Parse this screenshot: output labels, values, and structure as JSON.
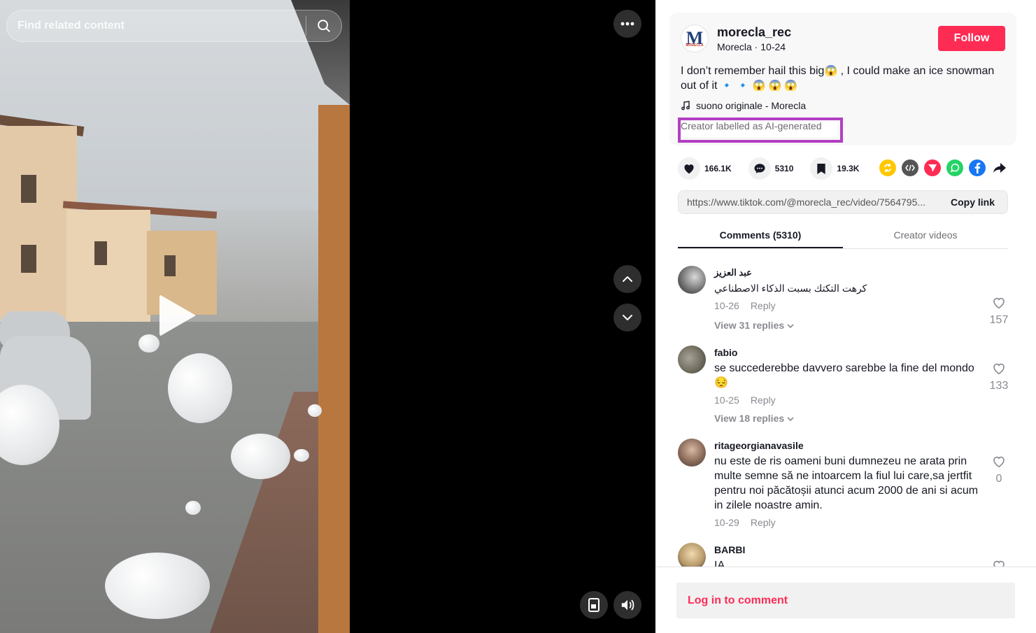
{
  "search": {
    "placeholder": "Find related content"
  },
  "post": {
    "username": "morecla_rec",
    "display_name": "Morecla",
    "date": "10-24",
    "follow_label": "Follow",
    "caption_part1": "I don’t remember hail this big",
    "caption_part2": " , I could make an ice snowman out of it ",
    "caption_emojis": "🔹 🔹 😱 😱 😱",
    "music": "suono originale - Morecla",
    "ai_label": "Creator labelled as AI-generated",
    "avatar_letter": "M",
    "avatar_sub": "MORECLA"
  },
  "stats": {
    "likes": "166.1K",
    "comments": "5310",
    "saves": "19.3K"
  },
  "share": {
    "link": "https://www.tiktok.com/@morecla_rec/video/7564795...",
    "copy_label": "Copy link"
  },
  "tabs": [
    {
      "label": "Comments (5310)"
    },
    {
      "label": "Creator videos"
    }
  ],
  "comments": [
    {
      "name": "عبد العزيز",
      "text": "كرهت التكتك بسبت الذكاء الاصطناعي",
      "date": "10-26",
      "reply": "Reply",
      "view_replies": "View 31 replies",
      "likes": "157"
    },
    {
      "name": "fabio",
      "text": "se succederebbe davvero sarebbe la fine del mondo 😔",
      "date": "10-25",
      "reply": "Reply",
      "view_replies": "View 18 replies",
      "likes": "133"
    },
    {
      "name": "ritageorgianavasile",
      "text": "nu este de ris oameni buni dumnezeu ne arata prin multe semne să ne intoarcem la fiul lui care,sa jertfit pentru noi păcătoșii atunci acum 2000 de ani si acum in zilele noastre amin.",
      "date": "10-29",
      "reply": "Reply",
      "likes": "0"
    },
    {
      "name": "BARBI",
      "text": "IA"
    }
  ],
  "login": {
    "label": "Log in to comment"
  },
  "colors": {
    "accent": "#fe2c55",
    "highlight": "#b23fc2"
  }
}
